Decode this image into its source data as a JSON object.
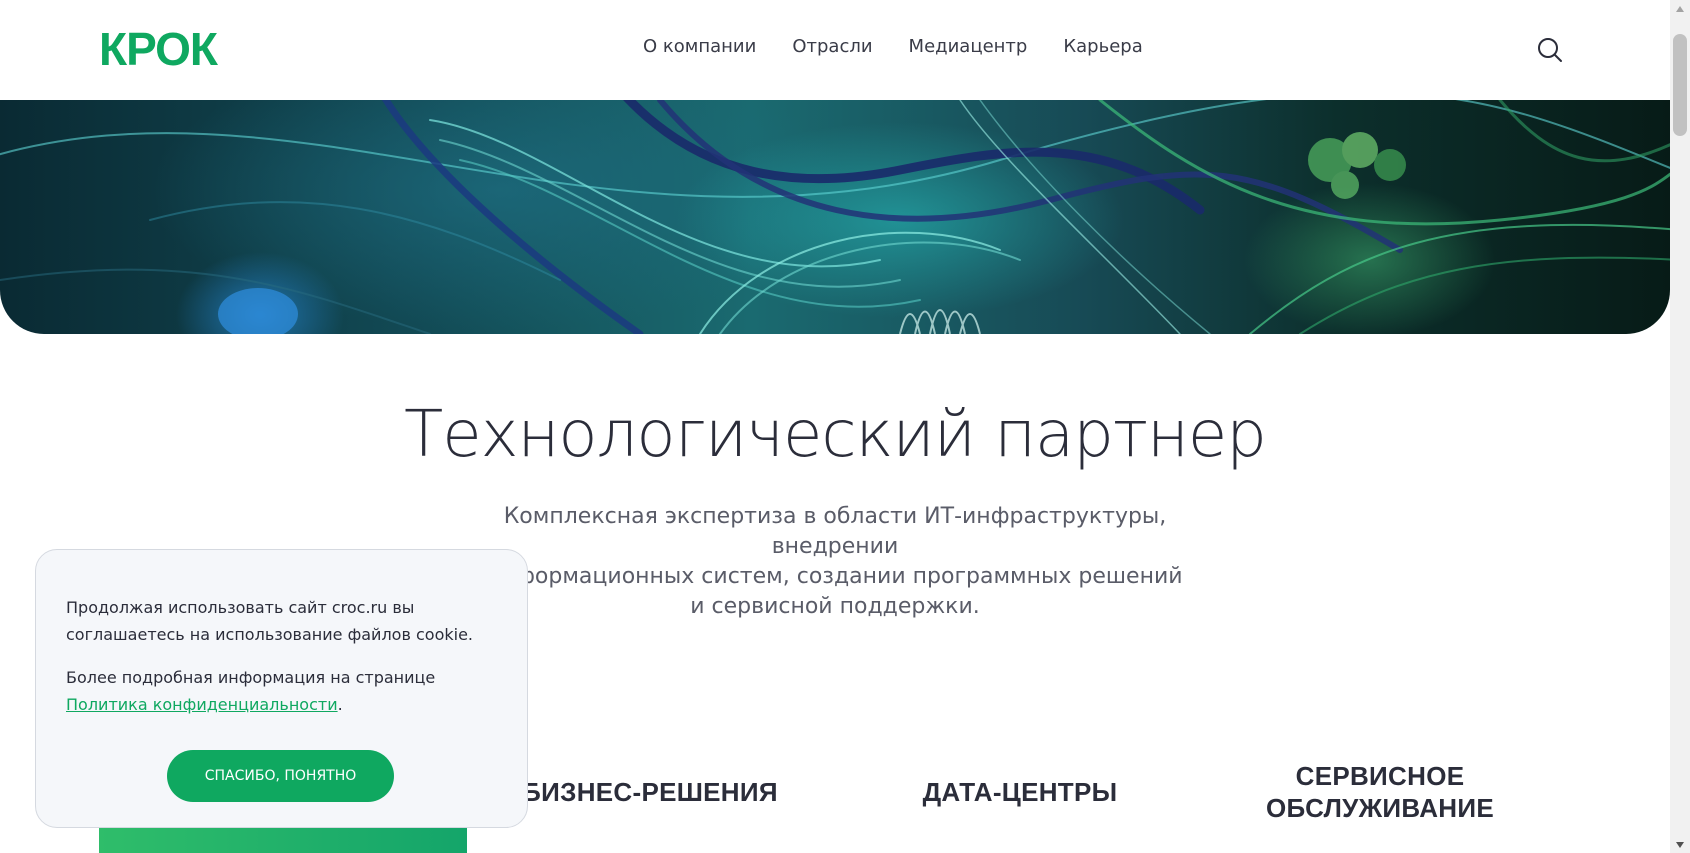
{
  "header": {
    "logo": "КРОК",
    "nav": [
      "О компании",
      "Отрасли",
      "Медиацентр",
      "Карьера"
    ],
    "search_icon": "search-icon"
  },
  "hero": {
    "image": "abstract teal and green fiber-optic cables underwater scene"
  },
  "main": {
    "title": "Технологический партнер",
    "subtitle_lines": [
      "Комплексная экспертиза в области ИТ-инфраструктуры, внедрении",
      "информационных систем, создании программных решений",
      "и сервисной поддержки."
    ],
    "categories": [
      {
        "lines": [
          "БИЗНЕС-РЕШЕНИЯ"
        ]
      },
      {
        "lines": [
          "ДАТА-ЦЕНТРЫ"
        ]
      },
      {
        "lines": [
          "СЕРВИСНОЕ",
          "ОБСЛУЖИВАНИЕ"
        ]
      }
    ]
  },
  "cookie": {
    "text1": "Продолжая использовать сайт croc.ru вы соглашаетесь на использование файлов cookie.",
    "text2_prefix": "Более подробная информация на странице ",
    "text2_link": "Политика конфиденциальности",
    "text2_suffix": ".",
    "button": "Спасибо, понятно"
  },
  "colors": {
    "brand_green": "#0fa860",
    "text_dark": "#2b2d3a"
  }
}
